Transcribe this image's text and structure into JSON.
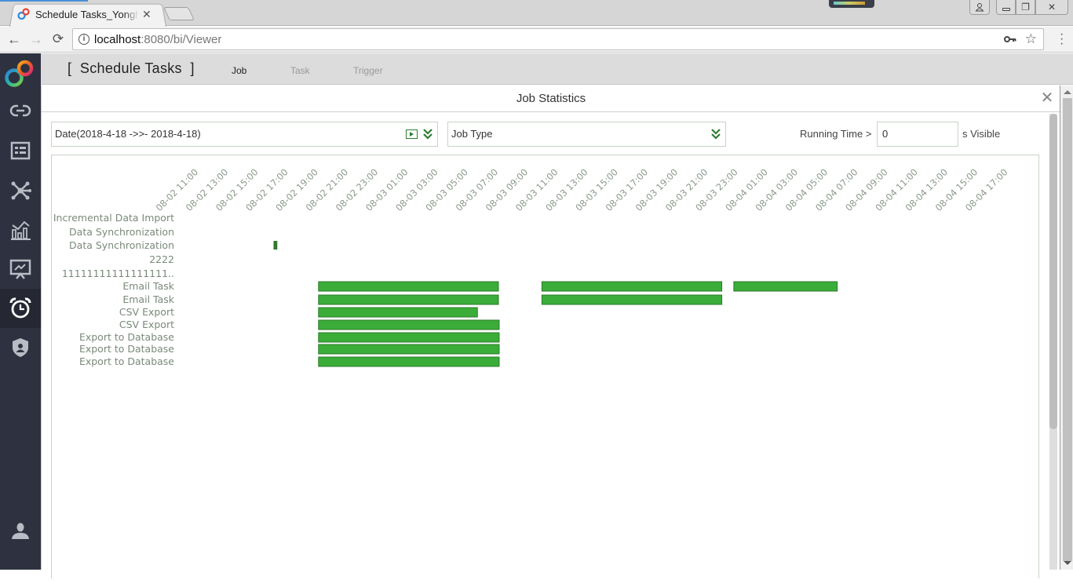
{
  "browser": {
    "tab_title": "Schedule Tasks_Yonghong",
    "url_host": "localhost",
    "url_rest": ":8080/bi/Viewer"
  },
  "sidebar": {
    "items": [
      {
        "icon": "link-icon",
        "label": "Data Source"
      },
      {
        "icon": "list-card-icon",
        "label": "Data Set"
      },
      {
        "icon": "network-icon",
        "label": "Data Mart"
      },
      {
        "icon": "bar-chart-icon",
        "label": "Analysis"
      },
      {
        "icon": "presentation-icon",
        "label": "Report"
      },
      {
        "icon": "alarm-clock-icon",
        "label": "Schedule Tasks",
        "active": true
      },
      {
        "icon": "shield-user-icon",
        "label": "Security"
      }
    ],
    "user_icon": "user-icon"
  },
  "app": {
    "title": "[  Schedule Tasks  ]",
    "tabs": [
      {
        "label": "Job",
        "active": true
      },
      {
        "label": "Task",
        "active": false
      },
      {
        "label": "Trigger",
        "active": false
      }
    ]
  },
  "dialog": {
    "title": "Job Statistics",
    "date_filter": "Date(2018-4-18 ->>- 2018-4-18)",
    "job_type_filter": "Job Type",
    "running_time_label": "Running Time >",
    "running_time_value": "0",
    "running_time_suffix": "s Visible"
  },
  "colors": {
    "bar_fill": "#3aad38",
    "bar_stroke": "#2c7a2a",
    "small_bar": "#2c7a2a",
    "label_text": "#7a8a7a",
    "tick_text": "#8a9a8a"
  },
  "chart_data": {
    "type": "gantt",
    "title": "Job Statistics",
    "x_axis": {
      "unit": "hours",
      "tick_labels": [
        "08-02 11:00",
        "08-02 13:00",
        "08-02 15:00",
        "08-02 17:00",
        "08-02 19:00",
        "08-02 21:00",
        "08-02 23:00",
        "08-03 01:00",
        "08-03 03:00",
        "08-03 05:00",
        "08-03 07:00",
        "08-03 09:00",
        "08-03 11:00",
        "08-03 13:00",
        "08-03 15:00",
        "08-03 17:00",
        "08-03 19:00",
        "08-03 21:00",
        "08-03 23:00",
        "08-04 01:00",
        "08-04 03:00",
        "08-04 05:00",
        "08-04 07:00",
        "08-04 09:00",
        "08-04 11:00",
        "08-04 13:00",
        "08-04 15:00",
        "08-04 17:00"
      ],
      "range_hours_from_first_tick": [
        0,
        54
      ]
    },
    "rows": [
      {
        "label": "Incremental Data Import",
        "runs": []
      },
      {
        "label": "Data Synchronization",
        "runs": []
      },
      {
        "label": "Data Synchronization",
        "runs": [
          {
            "start": 5.0,
            "end": 5.25,
            "start_label": "08-02 16:00",
            "end_label": "08-02 16:15"
          }
        ]
      },
      {
        "label": "2222",
        "runs": []
      },
      {
        "label": "11111111111111111..",
        "runs": []
      },
      {
        "label": "Email Task",
        "runs": [
          {
            "start": 8.0,
            "end": 20.0,
            "start_label": "08-02 19:00",
            "end_label": "08-03 07:00"
          },
          {
            "start": 22.9,
            "end": 34.9,
            "start_label": "08-03 09:55",
            "end_label": "08-03 21:55"
          },
          {
            "start": 35.7,
            "end": 42.6,
            "start_label": "08-03 22:40",
            "end_label": "08-04 05:35"
          }
        ]
      },
      {
        "label": "Email Task",
        "runs": [
          {
            "start": 8.0,
            "end": 20.0,
            "start_label": "08-02 19:00",
            "end_label": "08-03 07:00"
          },
          {
            "start": 22.9,
            "end": 34.9,
            "start_label": "08-03 09:55",
            "end_label": "08-03 21:55"
          }
        ]
      },
      {
        "label": "CSV Export",
        "runs": [
          {
            "start": 8.0,
            "end": 18.6,
            "start_label": "08-02 19:00",
            "end_label": "08-03 05:35"
          }
        ]
      },
      {
        "label": "CSV Export",
        "runs": [
          {
            "start": 8.0,
            "end": 20.05,
            "start_label": "08-02 19:00",
            "end_label": "08-03 07:05"
          }
        ]
      },
      {
        "label": "Export to Database",
        "runs": [
          {
            "start": 8.0,
            "end": 20.05,
            "start_label": "08-02 19:00",
            "end_label": "08-03 07:05"
          }
        ]
      },
      {
        "label": "Export to Database",
        "runs": [
          {
            "start": 8.0,
            "end": 20.05,
            "start_label": "08-02 19:00",
            "end_label": "08-03 07:05"
          }
        ]
      },
      {
        "label": "Export to Database",
        "runs": [
          {
            "start": 8.0,
            "end": 20.05,
            "start_label": "08-02 19:00",
            "end_label": "08-03 07:05"
          }
        ]
      }
    ],
    "legend": "none",
    "grid": false
  }
}
